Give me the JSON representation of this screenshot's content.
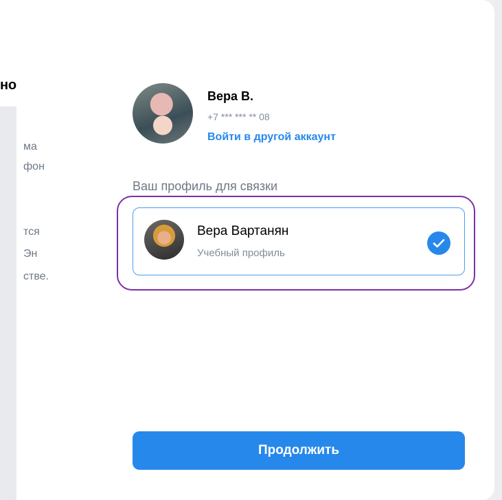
{
  "left": {
    "heading_fragment": "но",
    "text_lines": [
      "ма",
      "фон",
      "тся",
      "Эн",
      "стве."
    ]
  },
  "account": {
    "name": "Вера В.",
    "phone": "+7 *** *** ** 08",
    "switch_link": "Войти в другой аккаунт"
  },
  "profile_section": {
    "title": "Ваш профиль для связки",
    "selected_profile": {
      "name": "Вера Вартанян",
      "subtitle": "Учебный профиль",
      "selected": true
    }
  },
  "actions": {
    "continue_label": "Продолжить"
  },
  "colors": {
    "accent": "#2688eb",
    "highlight": "#7b2ea6",
    "secondary_text": "#818c99"
  },
  "icons": {
    "check": "check-icon"
  }
}
